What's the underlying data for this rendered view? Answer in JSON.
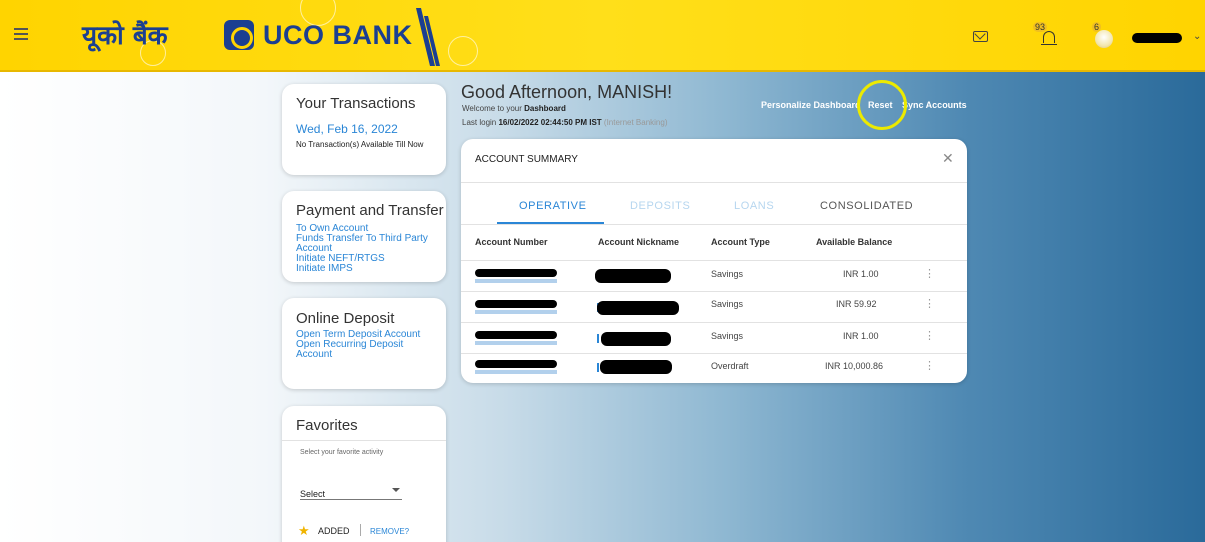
{
  "header": {
    "brand_hindi": "यूको बैंक",
    "brand_name": "UCO BANK",
    "notifications_count": "93",
    "profile_badge_count": "6"
  },
  "greeting": {
    "title": "Good Afternoon, MANISH!",
    "welcome_prefix": "Welcome to your",
    "welcome_bold": "Dashboard",
    "last_login_label": "Last login",
    "last_login_value": "16/02/2022 02:44:50 PM IST",
    "last_login_source": "(Internet Banking)"
  },
  "dashboard_links": {
    "personalize": "Personalize Dashboard",
    "reset": "Reset",
    "sync": "Sync Accounts"
  },
  "transactions_card": {
    "title": "Your Transactions",
    "date": "Wed, Feb 16, 2022",
    "empty_message": "No Transaction(s) Available Till Now"
  },
  "payment_card": {
    "title": "Payment and Transfer",
    "links": [
      "To Own Account",
      "Funds Transfer To Third Party Account",
      "Initiate NEFT/RTGS",
      "Initiate IMPS"
    ]
  },
  "deposit_card": {
    "title": "Online Deposit",
    "links": [
      "Open Term Deposit Account",
      "Open Recurring Deposit Account"
    ]
  },
  "favorites_card": {
    "title": "Favorites",
    "hint": "Select your favorite activity",
    "select_value": "Select",
    "added_label": "ADDED",
    "remove_label": "REMOVE?"
  },
  "account_summary": {
    "title": "ACCOUNT SUMMARY",
    "tabs": [
      "OPERATIVE",
      "DEPOSITS",
      "LOANS",
      "CONSOLIDATED"
    ],
    "active_tab": "OPERATIVE",
    "columns": [
      "Account Number",
      "Account Nickname",
      "Account Type",
      "Available Balance"
    ],
    "rows": [
      {
        "type": "Savings",
        "balance": "INR 1.00"
      },
      {
        "type": "Savings",
        "balance": "INR 59.92"
      },
      {
        "type": "Savings",
        "balance": "INR 1.00"
      },
      {
        "type": "Overdraft",
        "balance": "INR 10,000.86"
      }
    ]
  },
  "colors": {
    "brand_yellow": "#ffd400",
    "brand_blue": "#1b3f91",
    "link_blue": "#2a86d6",
    "highlight_ring": "#ecea00"
  }
}
